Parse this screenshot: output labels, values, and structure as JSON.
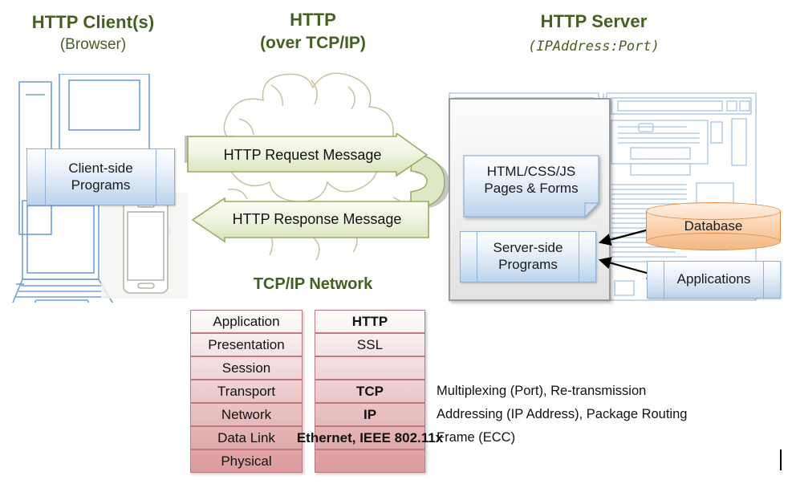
{
  "headers": {
    "client": {
      "title": "HTTP Client(s)",
      "subtitle": "(Browser)"
    },
    "protocol": {
      "title": "HTTP",
      "subtitle": "(over TCP/IP)"
    },
    "server": {
      "title": "HTTP Server",
      "subtitle": "(IPAddress:Port)"
    }
  },
  "network": {
    "cloud_label": "TCP/IP Network"
  },
  "client": {
    "box_label_line1": "Client-side",
    "box_label_line2": "Programs",
    "devices": [
      "desktop-computer",
      "laptop-computer",
      "smartphone"
    ]
  },
  "messages": {
    "request": "HTTP Request Message",
    "response": "HTTP Response Message"
  },
  "server": {
    "pages_line1": "HTML/CSS/JS",
    "pages_line2": "Pages & Forms",
    "programs_line1": "Server-side",
    "programs_line2": "Programs",
    "database": "Database",
    "applications": "Applications"
  },
  "osi": {
    "layers": [
      "Application",
      "Presentation",
      "Session",
      "Transport",
      "Network",
      "Data Link",
      "Physical"
    ],
    "protocols": [
      "HTTP",
      "SSL",
      "",
      "TCP",
      "IP",
      "Ethernet, IEEE 802.11x",
      ""
    ],
    "protocols_bold": [
      true,
      false,
      false,
      true,
      true,
      true,
      false
    ],
    "notes": [
      "",
      "",
      "",
      "Multiplexing (Port), Re-transmission",
      "Addressing (IP Address), Package Routing",
      "Frame (ECC)",
      ""
    ]
  },
  "colors": {
    "heading_green": "#44601f",
    "arrow_green_fill": "#dfe8c4",
    "arrow_green_stroke": "#9aab63",
    "box_blue_border": "#8fb2d9",
    "table_pink_border": "#c0787e",
    "database_orange": "#f7c296",
    "cloud_outline": "#c9bfa2",
    "server_chassis_gray": "#9a9a9a"
  }
}
